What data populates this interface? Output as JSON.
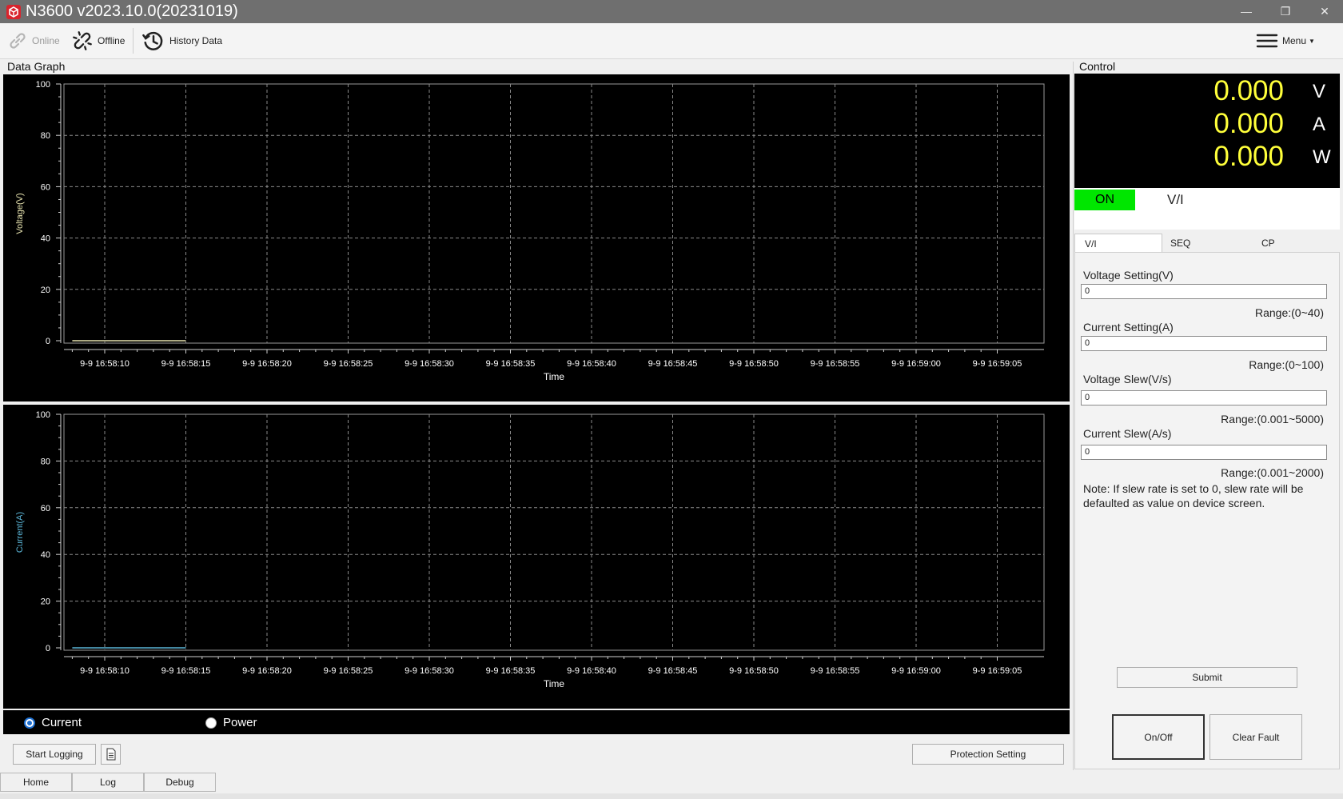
{
  "window": {
    "title": "N3600 v2023.10.0(20231019)",
    "controls": {
      "minimize": "—",
      "restore": "❐",
      "close": "✕"
    }
  },
  "toolbar": {
    "online": "Online",
    "offline": "Offline",
    "history": "History Data",
    "menu": "Menu"
  },
  "graph_section": {
    "title": "Data Graph"
  },
  "chart_data": [
    {
      "type": "line",
      "ylabel": "Voltage(V)",
      "xlabel": "Time",
      "ylim": [
        0,
        100
      ],
      "yticks": [
        "100",
        "80",
        "60",
        "40",
        "20",
        "0"
      ],
      "xticks": [
        "9-9 16:58:10",
        "9-9 16:58:15",
        "9-9 16:58:20",
        "9-9 16:58:25",
        "9-9 16:58:30",
        "9-9 16:58:35",
        "9-9 16:58:40",
        "9-9 16:58:45",
        "9-9 16:58:50",
        "9-9 16:58:55",
        "9-9 16:59:00",
        "9-9 16:59:05"
      ],
      "grid": true,
      "series_color": "#e8e4b0",
      "series": [
        {
          "x": [
            "9-9 16:58:08",
            "9-9 16:58:15"
          ],
          "values": [
            0,
            0
          ]
        }
      ]
    },
    {
      "type": "line",
      "ylabel": "Current(A)",
      "xlabel": "Time",
      "ylim": [
        0,
        100
      ],
      "yticks": [
        "100",
        "80",
        "60",
        "40",
        "20",
        "0"
      ],
      "xticks": [
        "9-9 16:58:10",
        "9-9 16:58:15",
        "9-9 16:58:20",
        "9-9 16:58:25",
        "9-9 16:58:30",
        "9-9 16:58:35",
        "9-9 16:58:40",
        "9-9 16:58:45",
        "9-9 16:58:50",
        "9-9 16:58:55",
        "9-9 16:59:00",
        "9-9 16:59:05"
      ],
      "grid": true,
      "series_color": "#5ab4d6",
      "series": [
        {
          "x": [
            "9-9 16:58:08",
            "9-9 16:58:15"
          ],
          "values": [
            0,
            0
          ]
        }
      ]
    }
  ],
  "radios": {
    "current": "Current",
    "power": "Power",
    "selected": "Current"
  },
  "actions": {
    "start_logging": "Start Logging",
    "protection": "Protection Setting"
  },
  "bottom_tabs": [
    "Home",
    "Log",
    "Debug"
  ],
  "control": {
    "title": "Control",
    "readout": {
      "voltage": "0.000",
      "voltage_unit": "V",
      "current": "0.000",
      "current_unit": "A",
      "power": "0.000",
      "power_unit": "W"
    },
    "status": "ON",
    "mode": "V/I",
    "tabs": [
      "V/I",
      "SEQ",
      "CP"
    ],
    "fields": {
      "voltage_label": "Voltage Setting(V)",
      "voltage_value": "0",
      "voltage_range": "Range:(0~40)",
      "current_label": "Current Setting(A)",
      "current_value": "0",
      "current_range": "Range:(0~100)",
      "vslew_label": "Voltage Slew(V/s)",
      "vslew_value": "0",
      "vslew_range": "Range:(0.001~5000)",
      "islew_label": "Current Slew(A/s)",
      "islew_value": "0",
      "islew_range": "Range:(0.001~2000)"
    },
    "note": "Note: If slew rate is set to 0, slew rate will be defaulted as value on device screen.",
    "submit": "Submit",
    "onoff": "On/Off",
    "clear_fault": "Clear Fault"
  },
  "colors": {
    "on_green": "#00e600",
    "readout_yellow": "#ffff3a",
    "radio_blue": "#1e6fd0"
  }
}
